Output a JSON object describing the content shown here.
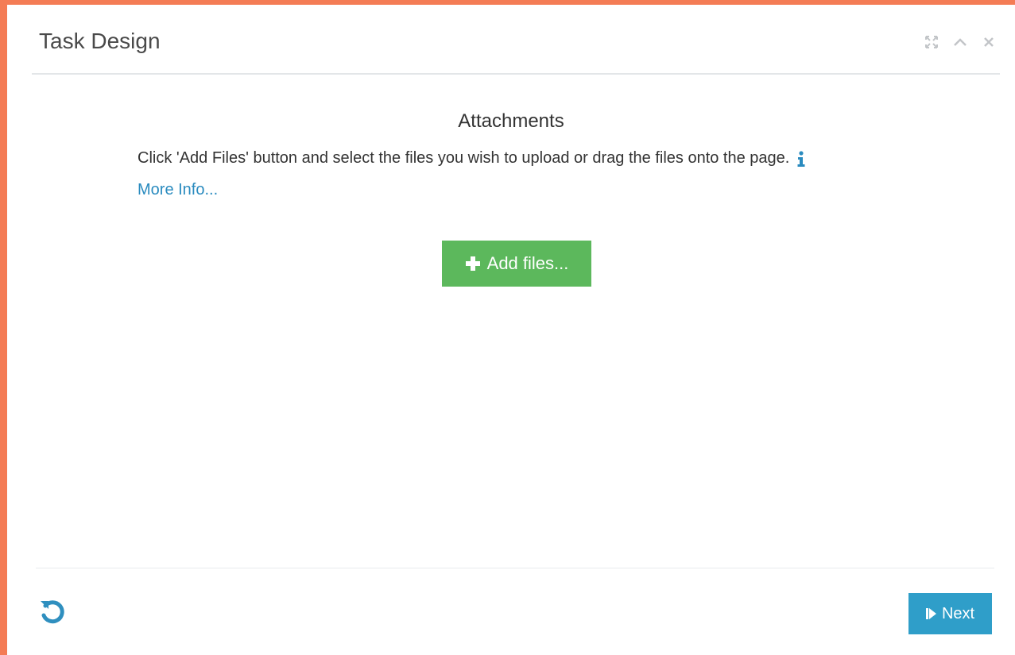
{
  "window": {
    "title": "Task Design",
    "controls": [
      "expand-icon",
      "collapse-icon",
      "close-icon"
    ]
  },
  "attachments": {
    "heading": "Attachments",
    "instructions": "Click 'Add Files' button and select the files you wish to upload or drag the files onto the page.",
    "more_info_link": "More Info...",
    "add_files_label": "Add files..."
  },
  "footer": {
    "next_label": "Next",
    "reset_icon": "undo-icon"
  },
  "colors": {
    "frame": "#f47c55",
    "add_button": "#5cb85c",
    "next_button": "#2f9ec9",
    "link": "#2a8bbf"
  }
}
